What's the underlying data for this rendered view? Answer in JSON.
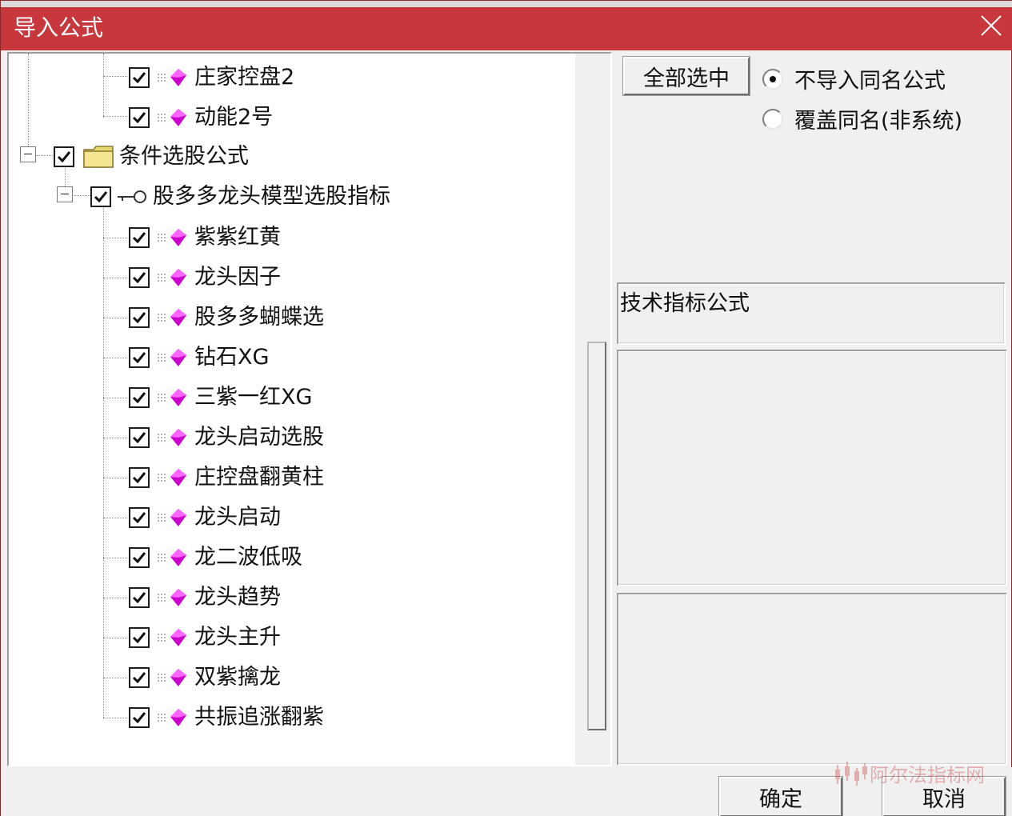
{
  "window": {
    "title": "导入公式"
  },
  "tree": {
    "top_items": [
      {
        "label": "庄家控盘2",
        "checked": true
      },
      {
        "label": "动能2号",
        "checked": true
      }
    ],
    "category": {
      "label": "条件选股公式",
      "checked": true,
      "expanded": true
    },
    "group": {
      "label": "股多多龙头模型选股指标",
      "checked": true,
      "expanded": true
    },
    "items": [
      {
        "label": "紫紫红黄",
        "checked": true
      },
      {
        "label": "龙头因子",
        "checked": true
      },
      {
        "label": "股多多蝴蝶选",
        "checked": true
      },
      {
        "label": "钻石XG",
        "checked": true
      },
      {
        "label": "三紫一红XG",
        "checked": true
      },
      {
        "label": "龙头启动选股",
        "checked": true
      },
      {
        "label": "庄控盘翻黄柱",
        "checked": true
      },
      {
        "label": "龙头启动",
        "checked": true
      },
      {
        "label": "龙二波低吸",
        "checked": true
      },
      {
        "label": "龙头趋势",
        "checked": true
      },
      {
        "label": "龙头主升",
        "checked": true
      },
      {
        "label": "双紫擒龙",
        "checked": true
      },
      {
        "label": "共振追涨翻紫",
        "checked": true
      }
    ]
  },
  "right_panel": {
    "select_all_label": "全部选中",
    "radio_options": [
      {
        "label": "不导入同名公式",
        "selected": true
      },
      {
        "label": "覆盖同名(非系统)",
        "selected": false
      }
    ],
    "formula_type": "技术指标公式"
  },
  "buttons": {
    "ok_label": "确定",
    "cancel_label": "取消"
  },
  "watermark": {
    "text": "阿尔法指标网"
  },
  "colors": {
    "titlebar": "#c8373c",
    "leaf_icon": "#cc00cc",
    "folder": "#e8d870"
  }
}
